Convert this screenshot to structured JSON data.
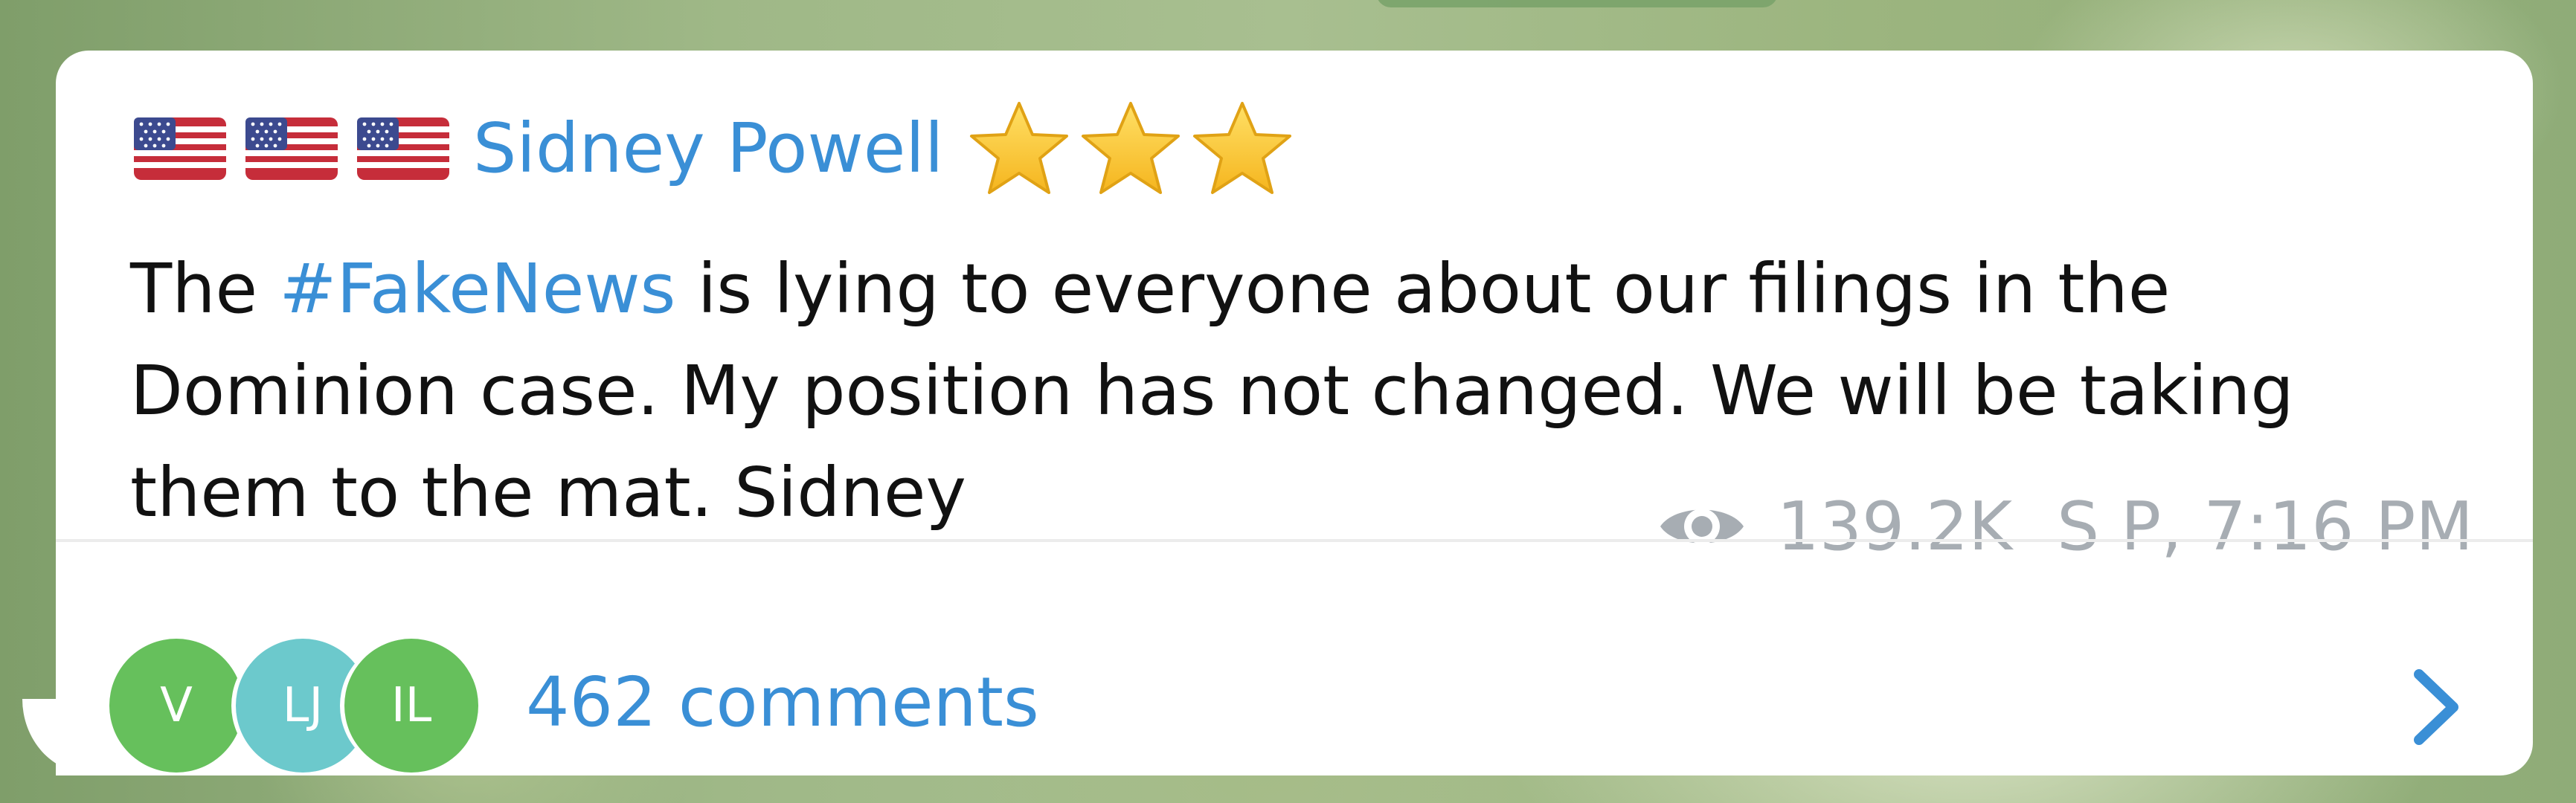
{
  "post": {
    "author": "Sidney Powell",
    "author_flags": [
      "us-flag",
      "us-flag",
      "us-flag"
    ],
    "author_stars": [
      "star",
      "star",
      "star"
    ],
    "message": {
      "before_hashtag": "The ",
      "hashtag": "#FakeNews",
      "after_hashtag": " is lying to everyone about our filings in the Dominion case. My position has not changed. We will be taking them to the mat. Sidney"
    },
    "views": "139.2K",
    "signature_time": "S P, 7:16 PM"
  },
  "comments": {
    "avatars": [
      {
        "initials": "V",
        "color": "#66c05c"
      },
      {
        "initials": "LJ",
        "color": "#6cc9cc"
      },
      {
        "initials": "IL",
        "color": "#66c05c"
      }
    ],
    "label": "462 comments"
  },
  "colors": {
    "accent": "#3a8fd6",
    "meta_text": "#a7adb3",
    "bubble": "#ffffff"
  },
  "icons": {
    "views": "eye-icon",
    "open_comments": "chevron-right-icon"
  }
}
